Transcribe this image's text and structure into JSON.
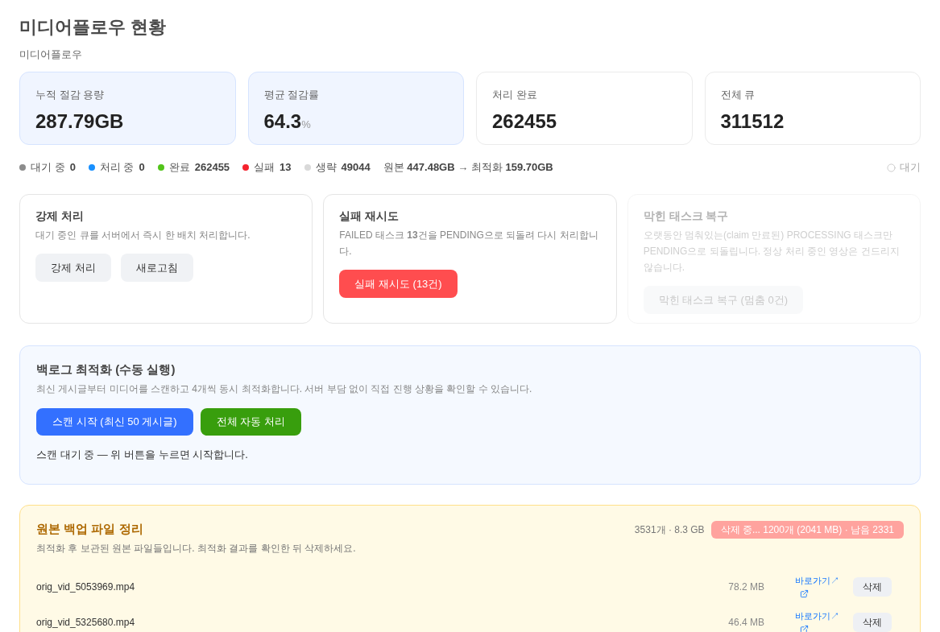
{
  "page": {
    "title": "미디어플로우 현황",
    "subtitle": "미디어플로우"
  },
  "stats": [
    {
      "label": "누적 절감 용량",
      "value": "287.79GB",
      "highlighted": true
    },
    {
      "label": "평균 절감률",
      "value": "64.3",
      "unit": "%",
      "highlighted": true
    },
    {
      "label": "처리 완료",
      "value": "262455",
      "highlighted": false
    },
    {
      "label": "전체 큐",
      "value": "311512",
      "highlighted": false
    }
  ],
  "status_bar": {
    "counts": [
      {
        "label": "대기 중",
        "count": "0",
        "color": "#8c8c8c"
      },
      {
        "label": "처리 중",
        "count": "0",
        "color": "#1890ff"
      },
      {
        "label": "완료",
        "count": "262455",
        "color": "#52c41a"
      },
      {
        "label": "실패",
        "count": "13",
        "color": "#f5222d"
      },
      {
        "label": "생략",
        "count": "49044",
        "color": "#d9d9d9"
      }
    ],
    "summary": "원본 **447.48GB** → 최적화 **159.70GB**",
    "state": "대기"
  },
  "actions": [
    {
      "title": "강제 처리",
      "description": "대기 중인 큐를 서버에서 즉시 한 배치 처리합니다.",
      "disabled": false,
      "buttons": [
        {
          "label": "강제 처리",
          "kind": "secondary"
        },
        {
          "label": "새로고침",
          "kind": "secondary"
        }
      ]
    },
    {
      "title": "실패 재시도",
      "description": "FAILED 태스크 **13**건을 PENDING으로 되돌려 다시 처리합니다.",
      "disabled": false,
      "buttons": [
        {
          "label": "실패 재시도 (13건)",
          "kind": "danger"
        }
      ]
    },
    {
      "title": "막힌 태스크 복구",
      "description": "오랫동안 멈춰있는(claim 만료된) PROCESSING 태스크만 PENDING으로 되돌립니다. 정상 처리 중인 영상은 건드리지 않습니다.",
      "disabled": true,
      "buttons": [
        {
          "label": "막힌 태스크 복구 (멈춤 0건)",
          "kind": "secondary"
        }
      ]
    }
  ],
  "backlog": {
    "title": "백로그 최적화 (수동 실행)",
    "description": "최신 게시글부터 미디어를 스캔하고 4개씩 동시 최적화합니다. 서버 부담 없이 직접 진행 상황을 확인할 수 있습니다.",
    "buttons": [
      {
        "label": "스캔 시작 (최신 50 게시글)",
        "kind": "primary"
      },
      {
        "label": "전체 자동 처리",
        "kind": "success"
      }
    ],
    "status": "스캔 대기 중 — 위 버튼을 누르면 시작합니다."
  },
  "backup": {
    "title": "원본 백업 파일 정리",
    "summary": "3531개 · 8.3 GB",
    "badge": "삭제 중... 1200개 (2041 MB) · 남음 2331",
    "description": "최적화 후 보관된 원본 파일들입니다. 최적화 결과를 확인한 뒤 삭제하세요.",
    "files": [
      {
        "name": "orig_vid_5053969.mp4",
        "size": "78.2 MB",
        "link": "바로가기↗",
        "action": "삭제"
      },
      {
        "name": "orig_vid_5325680.mp4",
        "size": "46.4 MB",
        "link": "바로가기↗",
        "action": "삭제"
      }
    ]
  }
}
